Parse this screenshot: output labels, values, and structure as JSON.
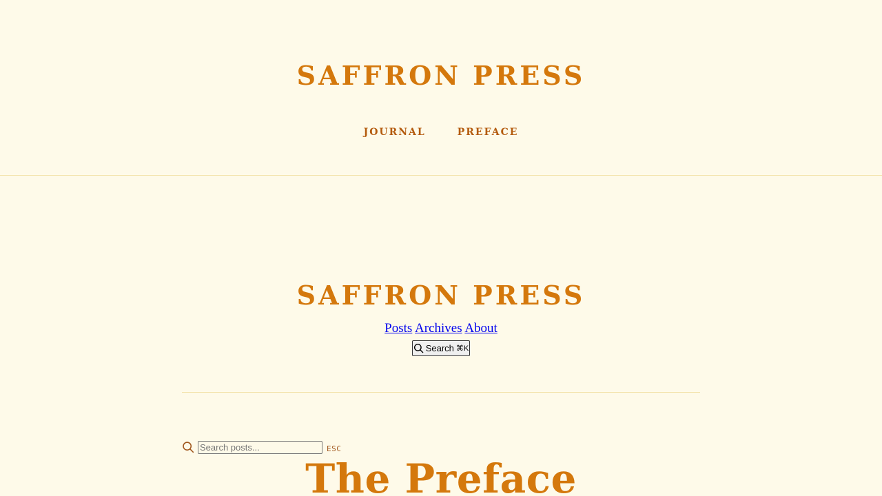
{
  "header": {
    "site_title": "SAFFRON PRESS",
    "nav": [
      {
        "label": "JOURNAL"
      },
      {
        "label": "PREFACE"
      }
    ]
  },
  "inner_header": {
    "site_title": "SAFFRON PRESS",
    "nav": [
      {
        "label": "Posts"
      },
      {
        "label": "Archives"
      },
      {
        "label": "About"
      }
    ],
    "search_button": {
      "label": "Search",
      "shortcut": "⌘K",
      "icon": "search-icon"
    }
  },
  "search": {
    "placeholder": "Search posts...",
    "value": "",
    "dismiss_key": "ESC",
    "icon": "search-icon"
  },
  "main": {
    "heading": "The Preface"
  },
  "colors": {
    "background": "#fefae9",
    "accent": "#d4780c",
    "nav": "#b45b0e",
    "divider": "#f2e2a8",
    "link": "#0000ee"
  }
}
